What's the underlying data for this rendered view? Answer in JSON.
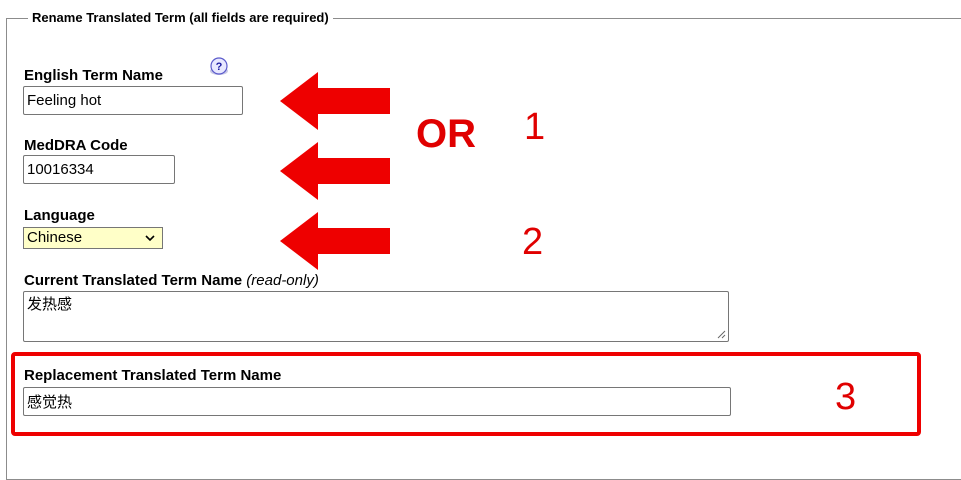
{
  "form": {
    "legend": "Rename Translated Term (all fields are required)",
    "english_term": {
      "label": "English Term Name",
      "value": "Feeling hot"
    },
    "meddra_code": {
      "label": "MedDRA Code",
      "value": "10016334"
    },
    "language": {
      "label": "Language",
      "selected": "Chinese"
    },
    "current_translated": {
      "label": "Current Translated Term Name",
      "note": "(read-only)",
      "value": "发热感"
    },
    "replacement_translated": {
      "label": "Replacement Translated Term Name",
      "value": "感觉热"
    }
  },
  "annotations": {
    "or_text": "OR",
    "step1": "1",
    "step2": "2",
    "step3": "3"
  },
  "icons": {
    "help": "help-question-icon",
    "arrow": "left-arrow-icon",
    "select_chevron": "chevron-down-icon"
  },
  "colors": {
    "annotation": "#e00000",
    "select_bg": "#ffffc8"
  }
}
